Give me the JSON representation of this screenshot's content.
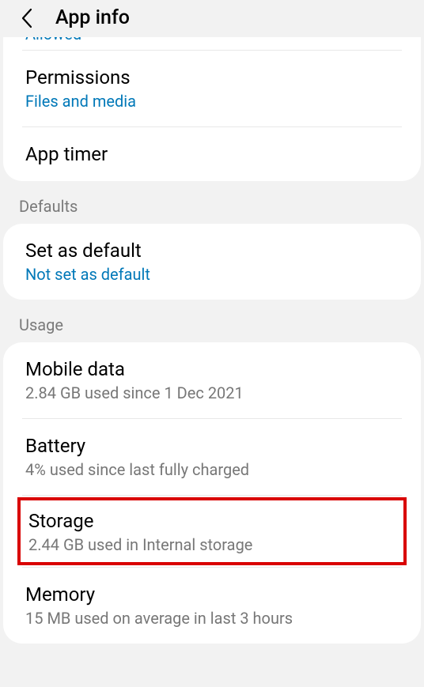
{
  "header": {
    "title": "App info"
  },
  "topCard": {
    "cutoffText": "Allowed",
    "permissions": {
      "title": "Permissions",
      "sub": "Files and media"
    },
    "appTimer": {
      "title": "App timer"
    }
  },
  "defaults": {
    "sectionLabel": "Defaults",
    "setDefault": {
      "title": "Set as default",
      "sub": "Not set as default"
    }
  },
  "usage": {
    "sectionLabel": "Usage",
    "mobileData": {
      "title": "Mobile data",
      "sub": "2.84 GB used since 1 Dec 2021"
    },
    "battery": {
      "title": "Battery",
      "sub": "4% used since last fully charged"
    },
    "storage": {
      "title": "Storage",
      "sub": "2.44 GB used in Internal storage"
    },
    "memory": {
      "title": "Memory",
      "sub": "15 MB used on average in last 3 hours"
    }
  }
}
